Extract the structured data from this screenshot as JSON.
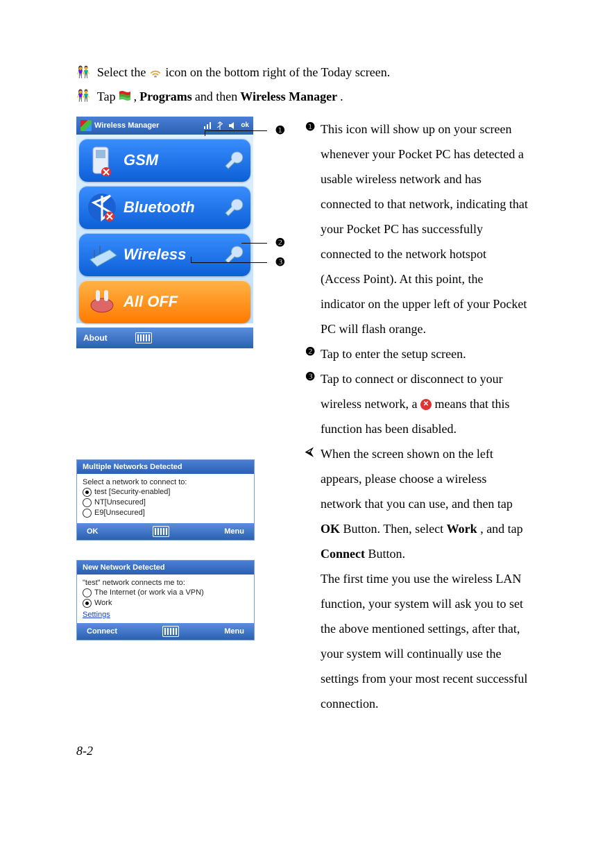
{
  "intro": {
    "line1_pre": "Select the",
    "line1_post": "icon on the bottom right of the Today screen.",
    "line2_pre": "Tap",
    "line2_mid": ",",
    "line2_programs": "Programs",
    "line2_and": "and then",
    "line2_wm": "Wireless Manager",
    "line2_end": "."
  },
  "wireless_manager": {
    "title": "Wireless Manager",
    "ok": "ok",
    "tiles": {
      "gsm": "GSM",
      "bluetooth": "Bluetooth",
      "wireless": "Wireless",
      "alloff": "All OFF"
    },
    "footer_about": "About"
  },
  "callouts": {
    "n1": "❶",
    "n2": "❷",
    "n3": "❸",
    "nC": "⮘",
    "text1": "This icon will show up on your screen whenever your Pocket PC has detected a usable wireless network and has connected to that network, indicating that your Pocket PC has successfully connected to the network hotspot (Access Point). At this point, the indicator on the upper left of your Pocket PC will flash orange.",
    "text2": "Tap to enter the setup screen.",
    "text3a": "Tap to connect or disconnect to your wireless network, a",
    "text3b": "means that this function has been disabled.",
    "textCa": "When the screen shown on the left appears, please choose a wireless network that you can use, and then tap",
    "textC_ok": "OK",
    "textCb": "Button. Then, select",
    "textC_work": "Work",
    "textCc": ", and tap",
    "textC_connect": "Connect",
    "textCd": "Button.",
    "textC_last": "The first time you use the wireless LAN function, your system will ask you to set the above mentioned settings, after that, your system will continually use the settings from your most recent successful connection."
  },
  "popup1": {
    "title": "Multiple Networks Detected",
    "subtitle": "Select a network to connect to:",
    "opt1": "test [Security-enabled]",
    "opt2": "NT[Unsecured]",
    "opt3": "E9[Unsecured]",
    "ok": "OK",
    "menu": "Menu"
  },
  "popup2": {
    "title": "New Network Detected",
    "subtitle": "\"test\" network connects me to:",
    "opt1": "The Internet (or work via a VPN)",
    "opt2": "Work",
    "settings": "Settings",
    "connect": "Connect",
    "menu": "Menu"
  },
  "page_number": "8-2"
}
